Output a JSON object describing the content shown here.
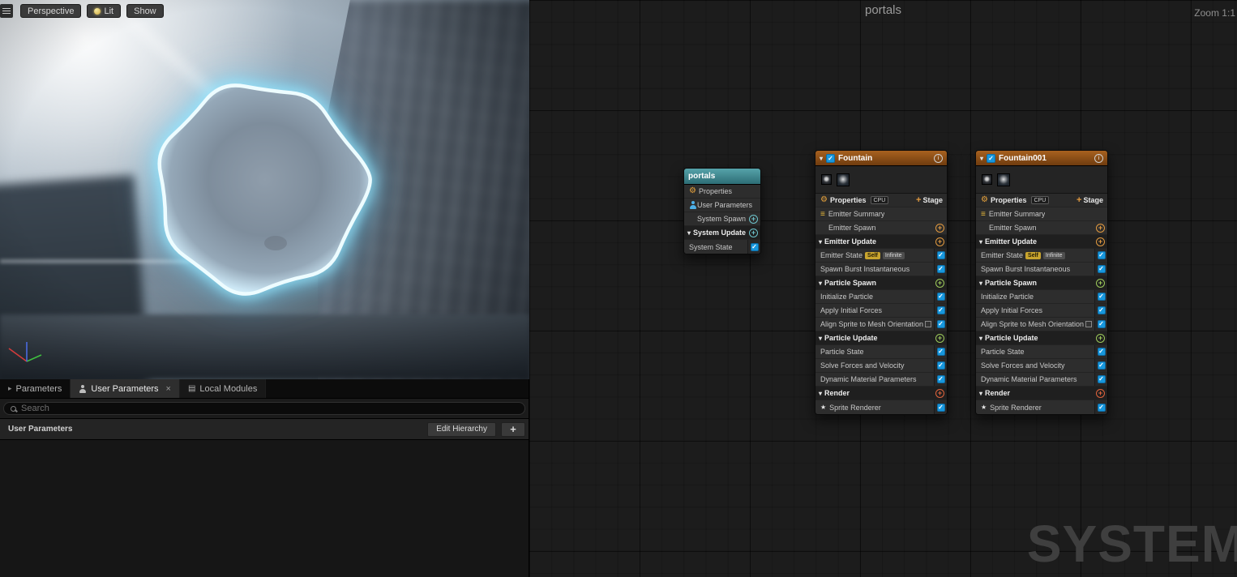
{
  "icons": {
    "menu": "≡",
    "collapse": "▾",
    "expand": "▸",
    "check": "✓",
    "plus": "+",
    "info": "i",
    "wrench": "⚙",
    "summary": "≡",
    "star": "★",
    "modules": "▤",
    "close": "×"
  },
  "colors": {
    "emitter_header": "#a8611f",
    "system_header": "#3f8f97",
    "checkbox_blue": "#1797dd",
    "self_badge": "#c8a42e",
    "plus_orange": "#e29a40",
    "plus_green": "#9cc95a",
    "plus_red": "#e0633c",
    "portal_glow": "#7fe3ff"
  },
  "viewport": {
    "toolbar": {
      "perspective": "Perspective",
      "lit": "Lit",
      "show": "Show"
    },
    "tabs": {
      "parameters": "Parameters",
      "user_parameters": "User Parameters",
      "local_modules": "Local Modules"
    },
    "search": {
      "placeholder": "Search"
    },
    "user_params_panel": {
      "title": "User Parameters",
      "edit_hierarchy": "Edit Hierarchy",
      "add": "+"
    }
  },
  "graph": {
    "title": "portals",
    "zoom_label": "Zoom 1:1",
    "watermark": "SYSTEM",
    "system_node": {
      "title": "portals",
      "rows": [
        {
          "kind": "iconrow",
          "icon": "wrench",
          "label": "Properties"
        },
        {
          "kind": "iconrow",
          "icon": "user",
          "label": "User Parameters"
        },
        {
          "kind": "plusrow",
          "label": "System Spawn",
          "color": "teal"
        },
        {
          "kind": "section",
          "label": "System Update",
          "color": "teal"
        },
        {
          "kind": "module",
          "label": "System State"
        }
      ]
    },
    "emitters": [
      {
        "title": "Fountain",
        "properties": {
          "label": "Properties",
          "cpu": "CPU",
          "stage": "Stage"
        },
        "rows": [
          {
            "kind": "summary",
            "label": "Emitter Summary"
          },
          {
            "kind": "plusrow",
            "label": "Emitter Spawn",
            "color": "orange"
          },
          {
            "kind": "section",
            "label": "Emitter Update",
            "color": "orange"
          },
          {
            "kind": "module",
            "label": "Emitter State",
            "badges": [
              "Self",
              "Infinite"
            ]
          },
          {
            "kind": "module",
            "label": "Spawn Burst Instantaneous"
          },
          {
            "kind": "section",
            "label": "Particle Spawn",
            "color": "green"
          },
          {
            "kind": "module",
            "label": "Initialize Particle"
          },
          {
            "kind": "module",
            "label": "Apply Initial Forces"
          },
          {
            "kind": "module",
            "label": "Align Sprite to Mesh Orientation",
            "boxicon": true
          },
          {
            "kind": "section",
            "label": "Particle Update",
            "color": "green"
          },
          {
            "kind": "module",
            "label": "Particle State"
          },
          {
            "kind": "module",
            "label": "Solve Forces and Velocity"
          },
          {
            "kind": "module",
            "label": "Dynamic Material Parameters"
          },
          {
            "kind": "section",
            "label": "Render",
            "color": "red"
          },
          {
            "kind": "module",
            "label": "Sprite Renderer",
            "star": true
          }
        ]
      },
      {
        "title": "Fountain001",
        "properties": {
          "label": "Properties",
          "cpu": "CPU",
          "stage": "Stage"
        },
        "rows": [
          {
            "kind": "summary",
            "label": "Emitter Summary"
          },
          {
            "kind": "plusrow",
            "label": "Emitter Spawn",
            "color": "orange"
          },
          {
            "kind": "section",
            "label": "Emitter Update",
            "color": "orange"
          },
          {
            "kind": "module",
            "label": "Emitter State",
            "badges": [
              "Self",
              "Infinite"
            ]
          },
          {
            "kind": "module",
            "label": "Spawn Burst Instantaneous"
          },
          {
            "kind": "section",
            "label": "Particle Spawn",
            "color": "green"
          },
          {
            "kind": "module",
            "label": "Initialize Particle"
          },
          {
            "kind": "module",
            "label": "Apply Initial Forces"
          },
          {
            "kind": "module",
            "label": "Align Sprite to Mesh Orientation",
            "boxicon": true
          },
          {
            "kind": "section",
            "label": "Particle Update",
            "color": "green"
          },
          {
            "kind": "module",
            "label": "Particle State"
          },
          {
            "kind": "module",
            "label": "Solve Forces and Velocity"
          },
          {
            "kind": "module",
            "label": "Dynamic Material Parameters"
          },
          {
            "kind": "section",
            "label": "Render",
            "color": "red"
          },
          {
            "kind": "module",
            "label": "Sprite Renderer",
            "star": true
          }
        ]
      }
    ]
  }
}
